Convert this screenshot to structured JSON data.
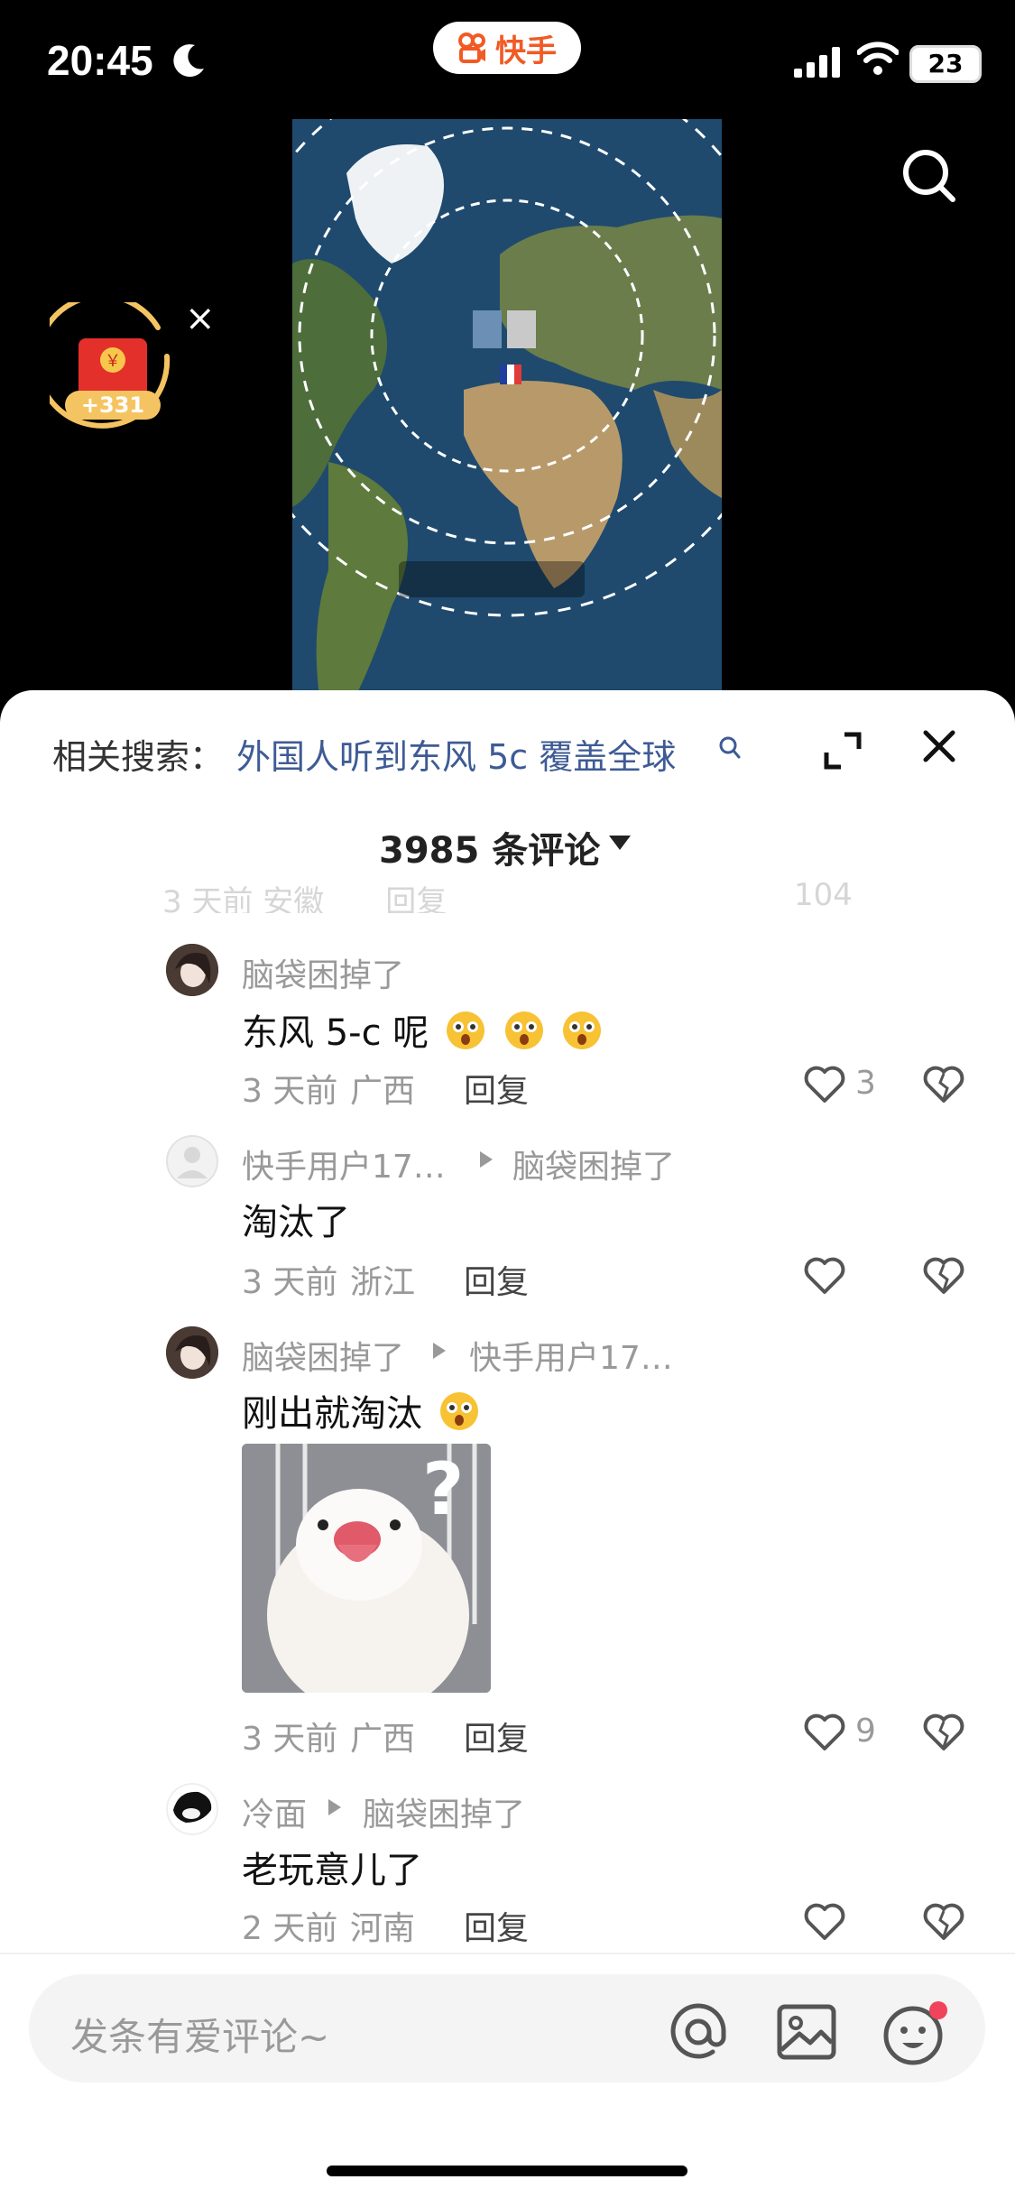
{
  "status_bar": {
    "time": "20:45",
    "battery": "23"
  },
  "app": {
    "name": "快手"
  },
  "red_packet": {
    "amount": "+331"
  },
  "sheet": {
    "related_label": "相关搜索：",
    "related_query": "外国人听到东风 5c 覆盖全球",
    "comment_count": "3985 条评论"
  },
  "faded_row": {
    "text": "3 天前 安徽　　回复",
    "likes": "104"
  },
  "comments": [
    {
      "user": "脑袋困掉了",
      "reply_to": "",
      "text": "东风 5-c 呢",
      "time": "3 天前",
      "location": "广西",
      "reply": "回复",
      "likes": "3"
    },
    {
      "user": "快手用户17…",
      "reply_to": "脑袋困掉了",
      "text": "淘汰了",
      "time": "3 天前",
      "location": "浙江",
      "reply": "回复",
      "likes": ""
    },
    {
      "user": "脑袋困掉了",
      "reply_to": "快手用户17…",
      "text": "刚出就淘汰",
      "time": "3 天前",
      "location": "广西",
      "reply": "回复",
      "likes": "9"
    },
    {
      "user": "冷面",
      "reply_to": "脑袋困掉了",
      "text": "老玩意儿了",
      "time": "2 天前",
      "location": "河南",
      "reply": "回复",
      "likes": ""
    }
  ],
  "input": {
    "placeholder": "发条有爱评论~"
  },
  "colors": {
    "brand": "#f15a24",
    "link": "#3e5b95",
    "notification": "#f0445a"
  }
}
